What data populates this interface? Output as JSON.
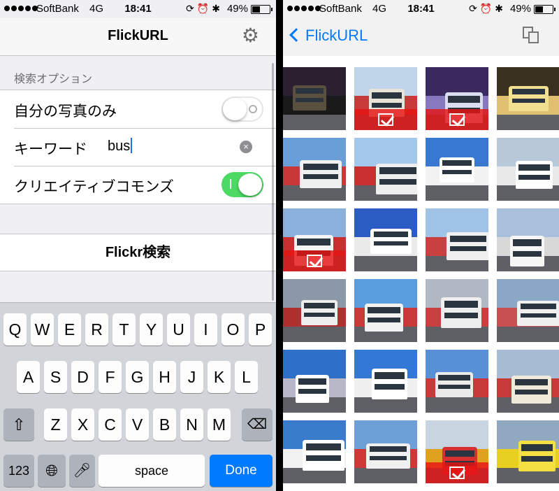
{
  "status_left": {
    "carrier": "SoftBank",
    "network": "4G",
    "time": "18:41",
    "battery": "49%",
    "icons": "⟳⏰✱"
  },
  "status_right": {
    "carrier": "SoftBank",
    "network": "4G",
    "time": "18:41",
    "battery": "49%",
    "icons": "⟳⏰✱"
  },
  "search_screen": {
    "title": "FlickURL",
    "section_header": "検索オプション",
    "rows": [
      {
        "label": "自分の写真のみ",
        "switch_on": false
      },
      {
        "label": "キーワード",
        "value": "bus"
      },
      {
        "label": "クリエイティブコモンズ",
        "switch_on": true
      }
    ],
    "search_button": "Flickr検索"
  },
  "keyboard": {
    "row1": [
      "Q",
      "W",
      "E",
      "R",
      "T",
      "Y",
      "U",
      "I",
      "O",
      "P"
    ],
    "row2": [
      "A",
      "S",
      "D",
      "F",
      "G",
      "H",
      "J",
      "K",
      "L"
    ],
    "row3": [
      "Z",
      "X",
      "C",
      "V",
      "B",
      "N",
      "M"
    ],
    "numbers": "123",
    "space": "space",
    "done": "Done"
  },
  "results_screen": {
    "back_label": "FlickURL",
    "thumbnails": [
      {
        "sky": "#2a2030",
        "body": "#1a1a1a",
        "bus": "#5a5040",
        "selected": false
      },
      {
        "sky": "#c0d4ea",
        "body": "#c93a3a",
        "bus": "#e8e4da",
        "selected": true
      },
      {
        "sky": "#3a2a60",
        "body": "#8878c0",
        "bus": "#dcdcf0",
        "selected": true
      },
      {
        "sky": "#3a3020",
        "body": "#e0c070",
        "bus": "#f2e090",
        "selected": false
      },
      {
        "sky": "#6a9ed8",
        "body": "#c83838",
        "bus": "#f0f0f0",
        "selected": false
      },
      {
        "sky": "#a4c8ec",
        "body": "#c83030",
        "bus": "#eeeeee",
        "selected": false
      },
      {
        "sky": "#3878d0",
        "body": "#f2f2f2",
        "bus": "#ffffff",
        "selected": false
      },
      {
        "sky": "#b8c8d8",
        "body": "#e8e8e8",
        "bus": "#ffffff",
        "selected": false
      },
      {
        "sky": "#8ab0dc",
        "body": "#c83030",
        "bus": "#f4f4f4",
        "selected": true
      },
      {
        "sky": "#2a5cc4",
        "body": "#eaeaea",
        "bus": "#ffffff",
        "selected": false
      },
      {
        "sky": "#a0c4e8",
        "body": "#c84040",
        "bus": "#f0f0f0",
        "selected": false
      },
      {
        "sky": "#a8c0dc",
        "body": "#d8d8d8",
        "bus": "#f6f6f6",
        "selected": false
      },
      {
        "sky": "#8a98a8",
        "body": "#b03030",
        "bus": "#eeeeee",
        "selected": false
      },
      {
        "sky": "#5a9ee0",
        "body": "#c83a3a",
        "bus": "#f2f2f2",
        "selected": false
      },
      {
        "sky": "#b0b8c4",
        "body": "#c84040",
        "bus": "#eeeeee",
        "selected": false
      },
      {
        "sky": "#8ca8c8",
        "body": "#c85050",
        "bus": "#f0f0f0",
        "selected": false
      },
      {
        "sky": "#2e70c8",
        "body": "#b8b8c8",
        "bus": "#ffffff",
        "selected": false
      },
      {
        "sky": "#3278d4",
        "body": "#f0f0f0",
        "bus": "#ffffff",
        "selected": false
      },
      {
        "sky": "#5890d8",
        "body": "#c83a3a",
        "bus": "#eaeaea",
        "selected": false
      },
      {
        "sky": "#a8bcd4",
        "body": "#c83a3a",
        "bus": "#f0e8d8",
        "selected": false
      },
      {
        "sky": "#3a7ccc",
        "body": "#f2f2f2",
        "bus": "#ffffff",
        "selected": false
      },
      {
        "sky": "#6ea0d8",
        "body": "#d03838",
        "bus": "#f0f0f0",
        "selected": false
      },
      {
        "sky": "#c8d4e0",
        "body": "#e0a020",
        "bus": "#d83030",
        "selected": true
      },
      {
        "sky": "#90a8c0",
        "body": "#e8d020",
        "bus": "#f4e040",
        "selected": false
      }
    ]
  }
}
